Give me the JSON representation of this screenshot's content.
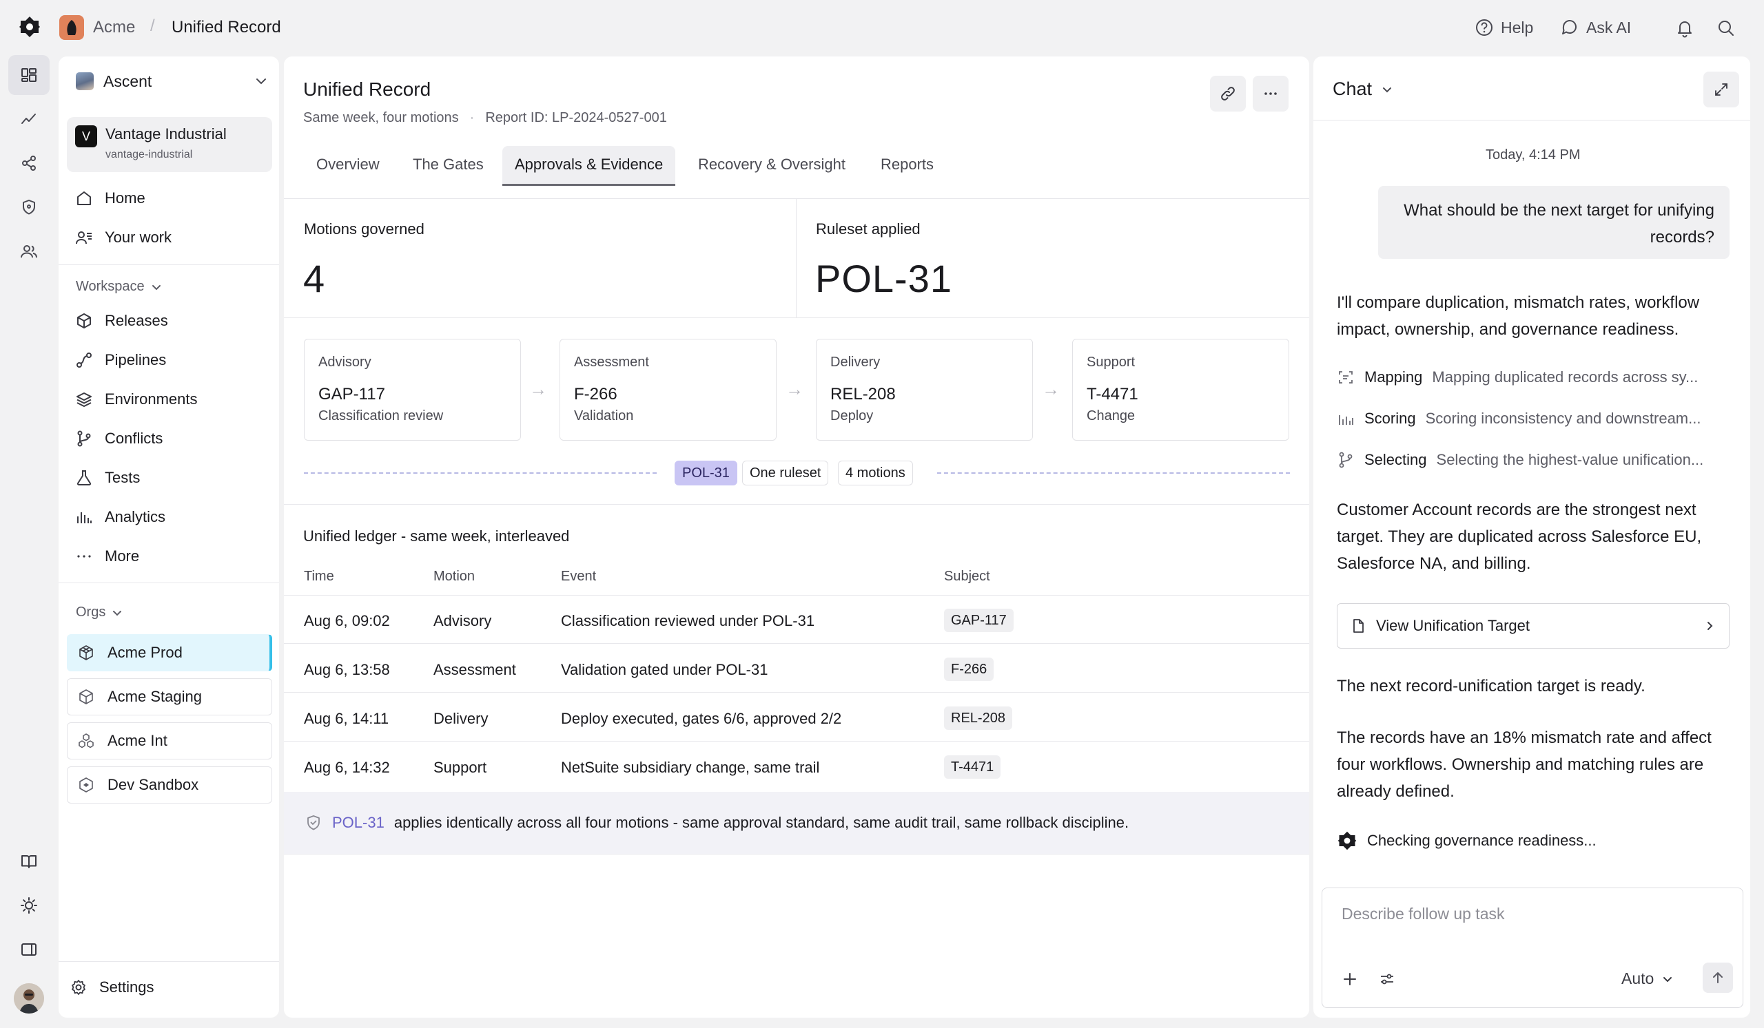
{
  "topbar": {
    "org": "Acme",
    "separator": "/",
    "page": "Unified Record",
    "help": "Help",
    "ask_ai": "Ask AI"
  },
  "sidebar": {
    "workspace": "Ascent",
    "account": {
      "badge": "V",
      "name": "Vantage Industrial",
      "slug": "vantage-industrial"
    },
    "primary": [
      {
        "label": "Home",
        "icon": "home-icon"
      },
      {
        "label": "Your work",
        "icon": "user-list-icon"
      }
    ],
    "workspace_title": "Workspace",
    "workspace_items": [
      {
        "label": "Releases",
        "icon": "box-icon"
      },
      {
        "label": "Pipelines",
        "icon": "pipeline-icon"
      },
      {
        "label": "Environments",
        "icon": "layers-icon"
      },
      {
        "label": "Conflicts",
        "icon": "git-branch-icon"
      },
      {
        "label": "Tests",
        "icon": "flask-icon"
      },
      {
        "label": "Analytics",
        "icon": "bar-chart-icon"
      },
      {
        "label": "More",
        "icon": "dots-icon"
      }
    ],
    "orgs_title": "Orgs",
    "orgs": [
      {
        "label": "Acme Prod",
        "active": true
      },
      {
        "label": "Acme Staging",
        "active": false
      },
      {
        "label": "Acme Int",
        "active": false
      },
      {
        "label": "Dev Sandbox",
        "active": false
      }
    ],
    "settings": "Settings"
  },
  "main": {
    "title": "Unified Record",
    "subtitle": "Same week, four motions",
    "report_id": "Report ID: LP-2024-0527-001",
    "tabs": [
      "Overview",
      "The Gates",
      "Approvals & Evidence",
      "Recovery & Oversight",
      "Reports"
    ],
    "active_tab": 2,
    "metrics": [
      {
        "label": "Motions governed",
        "value": "4"
      },
      {
        "label": "Ruleset applied",
        "value": "POL-31"
      }
    ],
    "stages": [
      {
        "label": "Advisory",
        "id": "GAP-117",
        "desc": "Classification review"
      },
      {
        "label": "Assessment",
        "id": "F-266",
        "desc": "Validation"
      },
      {
        "label": "Delivery",
        "id": "REL-208",
        "desc": "Deploy"
      },
      {
        "label": "Support",
        "id": "T-4471",
        "desc": "Change"
      }
    ],
    "arrow": "→",
    "chips": [
      "POL-31",
      "One ruleset",
      "4 motions"
    ],
    "ledger_title": "Unified ledger - same week, interleaved",
    "columns": [
      "Time",
      "Motion",
      "Event",
      "Subject"
    ],
    "rows": [
      {
        "time": "Aug 6, 09:02",
        "motion": "Advisory",
        "event": "Classification reviewed under POL-31",
        "subject": "GAP-117"
      },
      {
        "time": "Aug 6, 13:58",
        "motion": "Assessment",
        "event": "Validation gated under POL-31",
        "subject": "F-266"
      },
      {
        "time": "Aug 6, 14:11",
        "motion": "Delivery",
        "event": "Deploy executed, gates 6/6, approved 2/2",
        "subject": "REL-208"
      },
      {
        "time": "Aug 6, 14:32",
        "motion": "Support",
        "event": "NetSuite subsidiary change, same trail",
        "subject": "T-4471"
      }
    ],
    "banner_policy": "POL-31",
    "banner_text": "applies identically across all four motions - same approval standard, same audit trail, same rollback discipline."
  },
  "chat": {
    "title": "Chat",
    "time": "Today, 4:14 PM",
    "user_message": "What should be the next target for unifying records?",
    "intro": "I'll compare duplication, mismatch rates, workflow impact, ownership, and governance readiness.",
    "steps": [
      {
        "key": "Mapping",
        "desc": "Mapping duplicated records across sy...",
        "icon": "scan-icon"
      },
      {
        "key": "Scoring",
        "desc": "Scoring inconsistency and downstream...",
        "icon": "bars-icon"
      },
      {
        "key": "Selecting",
        "desc": "Selecting the highest-value unification...",
        "icon": "branch-icon"
      }
    ],
    "finding": "Customer Account records are the strongest next target. They are duplicated across Salesforce EU, Salesforce NA, and billing.",
    "target_button": "View Unification Target",
    "ready": "The next record-unification target is ready.",
    "details": "The records have an 18% mismatch rate and affect four workflows. Ownership and matching rules are already defined.",
    "status": "Checking governance readiness...",
    "composer_placeholder": "Describe follow up task",
    "mode": "Auto"
  }
}
